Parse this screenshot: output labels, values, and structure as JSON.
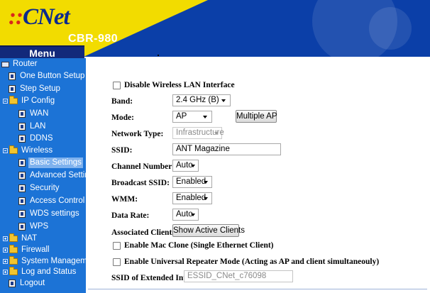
{
  "header": {
    "logo_prefix": "::",
    "logo_text": "CNet",
    "model": "CBR-980",
    "menu_label": "Menu"
  },
  "colors": {
    "header_blue": "#0b3fa8",
    "logo_yellow": "#f2dc00",
    "sidebar_blue": "#1c73d6",
    "menu_bar": "#12297a",
    "selected_bg": "#7fb2ee"
  },
  "sidebar": {
    "items": [
      {
        "label": "Router",
        "icon": "router-icon"
      },
      {
        "label": "One Button Setup",
        "icon": "page-icon"
      },
      {
        "label": "Step Setup",
        "icon": "page-icon"
      },
      {
        "label": "IP Config",
        "icon": "folder-icon",
        "expanded": true
      },
      {
        "label": "WAN",
        "icon": "page-icon"
      },
      {
        "label": "LAN",
        "icon": "page-icon"
      },
      {
        "label": "DDNS",
        "icon": "page-icon"
      },
      {
        "label": "Wireless",
        "icon": "folder-icon",
        "expanded": true
      },
      {
        "label": "Basic Settings",
        "icon": "page-icon",
        "selected": true
      },
      {
        "label": "Advanced Settings",
        "icon": "page-icon"
      },
      {
        "label": "Security",
        "icon": "page-icon"
      },
      {
        "label": "Access Control",
        "icon": "page-icon"
      },
      {
        "label": "WDS settings",
        "icon": "page-icon"
      },
      {
        "label": "WPS",
        "icon": "page-icon"
      },
      {
        "label": "NAT",
        "icon": "folder-icon",
        "expanded": false
      },
      {
        "label": "Firewall",
        "icon": "folder-icon",
        "expanded": false
      },
      {
        "label": "System Management",
        "icon": "folder-icon",
        "expanded": false
      },
      {
        "label": "Log and Status",
        "icon": "folder-icon",
        "expanded": false
      },
      {
        "label": "Logout",
        "icon": "page-icon"
      }
    ]
  },
  "form": {
    "disable_wlan_label": "Disable Wireless LAN Interface",
    "band_label": "Band:",
    "band_value": "2.4 GHz (B)",
    "mode_label": "Mode:",
    "mode_value": "AP",
    "multiple_ap_button": "Multiple AP",
    "network_type_label": "Network Type:",
    "network_type_value": "Infrastructure",
    "ssid_label": "SSID:",
    "ssid_value": "ANT Magazine",
    "channel_label": "Channel Number:",
    "channel_value": "Auto",
    "broadcast_label": "Broadcast SSID:",
    "broadcast_value": "Enabled",
    "wmm_label": "WMM:",
    "wmm_value": "Enabled",
    "data_rate_label": "Data Rate:",
    "data_rate_value": "Auto",
    "assoc_label": "Associated Clients:",
    "show_clients_button": "Show Active Clients",
    "mac_clone_label": "Enable Mac Clone (Single Ethernet Client)",
    "repeater_label": "Enable Universal Repeater Mode (Acting as AP and client simultaneouly)",
    "ext_ssid_label": "SSID of Extended Interface:",
    "ext_ssid_value": "ESSID_CNet_c76098"
  }
}
